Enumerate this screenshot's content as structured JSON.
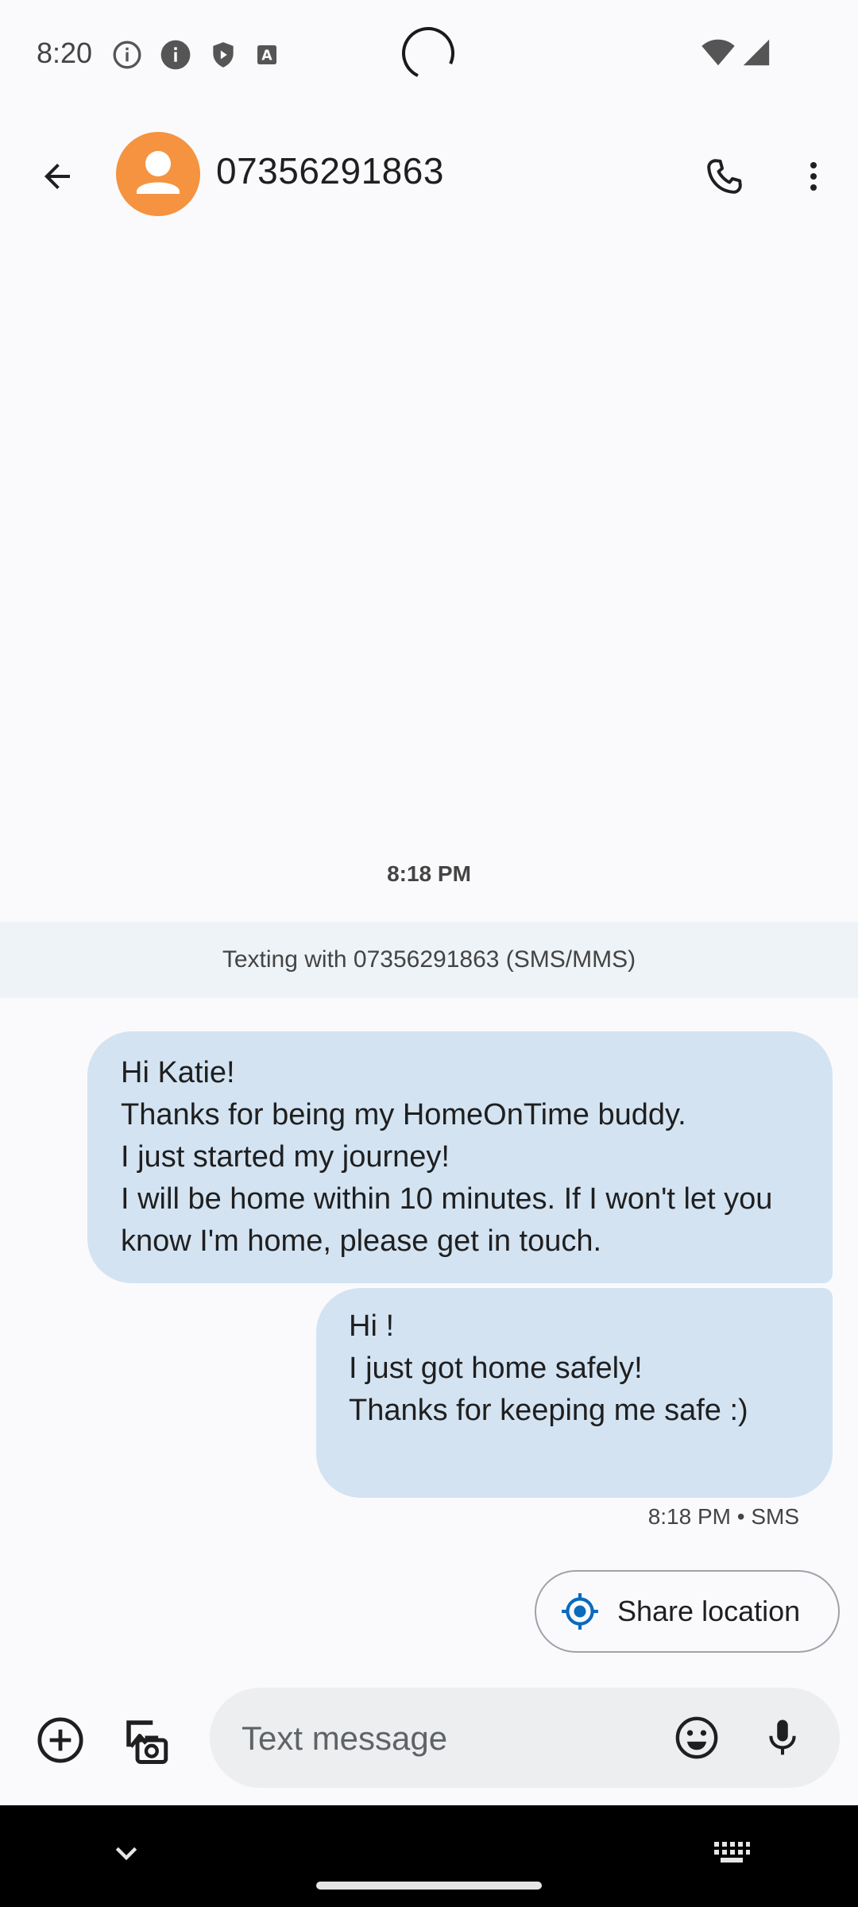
{
  "status_bar": {
    "time": "8:20",
    "icons_left": [
      "info-outline-icon",
      "info-filled-icon",
      "shield-play-icon",
      "font-a-icon"
    ],
    "icons_right": [
      "wifi-icon",
      "cellular-signal-icon"
    ]
  },
  "app_bar": {
    "contact_name": "07356291863",
    "avatar_color": "#f59340"
  },
  "conversation": {
    "timestamp": "8:18 PM",
    "info_banner": "Texting with 07356291863 (SMS/MMS)",
    "messages": [
      {
        "text": "Hi Katie!\nThanks for being my HomeOnTime buddy.\nI just started my journey!\nI will be home within 10 minutes. If I won't let you know I'm home, please get in touch."
      },
      {
        "text": "Hi !\nI just got home safely!\nThanks for keeping me safe :)"
      }
    ],
    "message_meta": "8:18 PM • SMS",
    "bubble_color": "#d3e3f2"
  },
  "suggestion": {
    "share_location_label": "Share location",
    "accent": "#0b6bbd"
  },
  "compose": {
    "placeholder": "Text message"
  }
}
